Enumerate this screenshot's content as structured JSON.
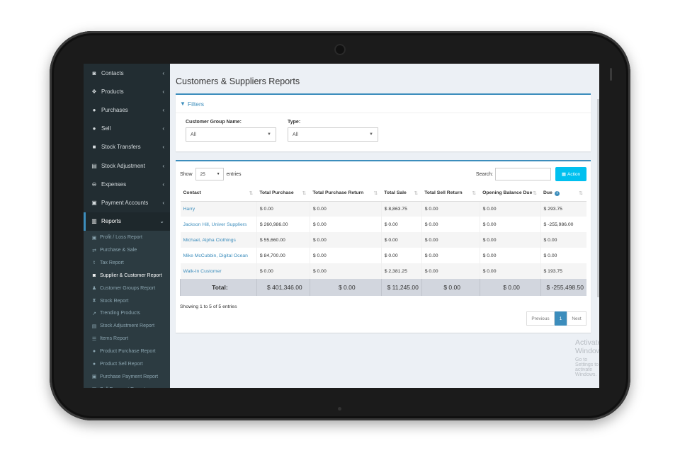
{
  "sidebar": {
    "items": [
      {
        "label": "Contacts",
        "icon": "address-book-icon",
        "glyph": "◙"
      },
      {
        "label": "Products",
        "icon": "cubes-icon",
        "glyph": "❖"
      },
      {
        "label": "Purchases",
        "icon": "arrow-circle-down-icon",
        "glyph": "●"
      },
      {
        "label": "Sell",
        "icon": "arrow-circle-up-icon",
        "glyph": "●"
      },
      {
        "label": "Stock Transfers",
        "icon": "truck-icon",
        "glyph": "■"
      },
      {
        "label": "Stock Adjustment",
        "icon": "database-icon",
        "glyph": "▤"
      },
      {
        "label": "Expenses",
        "icon": "minus-circle-icon",
        "glyph": "⊖"
      },
      {
        "label": "Payment Accounts",
        "icon": "money-icon",
        "glyph": "▣"
      },
      {
        "label": "Reports",
        "icon": "bar-chart-icon",
        "glyph": "▥"
      }
    ],
    "reports_sub": [
      {
        "label": "Profit / Loss Report",
        "icon": "money-icon",
        "glyph": "▣"
      },
      {
        "label": "Purchase & Sale",
        "icon": "exchange-icon",
        "glyph": "⇄"
      },
      {
        "label": "Tax Report",
        "icon": "tumblr-icon",
        "glyph": "t"
      },
      {
        "label": "Supplier & Customer Report",
        "icon": "address-book-icon",
        "glyph": "◙"
      },
      {
        "label": "Customer Groups Report",
        "icon": "users-icon",
        "glyph": "♟"
      },
      {
        "label": "Stock Report",
        "icon": "hourglass-icon",
        "glyph": "⧗"
      },
      {
        "label": "Trending Products",
        "icon": "line-chart-icon",
        "glyph": "↗"
      },
      {
        "label": "Stock Adjustment Report",
        "icon": "database-icon",
        "glyph": "▤"
      },
      {
        "label": "Items Report",
        "icon": "tasks-icon",
        "glyph": "☰"
      },
      {
        "label": "Product Purchase Report",
        "icon": "arrow-circle-down-icon",
        "glyph": "●"
      },
      {
        "label": "Product Sell Report",
        "icon": "arrow-circle-up-icon",
        "glyph": "●"
      },
      {
        "label": "Purchase Payment Report",
        "icon": "money-icon",
        "glyph": "▣"
      },
      {
        "label": "Sell Payment Report",
        "icon": "money-icon",
        "glyph": "▣"
      }
    ]
  },
  "page": {
    "title": "Customers & Suppliers Reports"
  },
  "filters": {
    "title": "Filters",
    "group_label": "Customer Group Name:",
    "group_value": "All",
    "type_label": "Type:",
    "type_value": "All"
  },
  "table_controls": {
    "show_label": "Show",
    "entries_value": "25",
    "entries_label": "entries",
    "search_label": "Search:",
    "action_label": "Action"
  },
  "table": {
    "columns": [
      "Contact",
      "Total Purchase",
      "Total Purchase Return",
      "Total Sale",
      "Total Sell Return",
      "Opening Balance Due",
      "Due"
    ],
    "rows": [
      [
        "Harry",
        "$ 0.00",
        "$ 0.00",
        "$ 8,863.75",
        "$ 0.00",
        "$ 0.00",
        "$ 293.75"
      ],
      [
        "Jackson Hill, Univer Suppliers",
        "$ 260,986.00",
        "$ 0.00",
        "$ 0.00",
        "$ 0.00",
        "$ 0.00",
        "$ -255,986.00"
      ],
      [
        "Michael, Alpha Clothings",
        "$ 55,660.00",
        "$ 0.00",
        "$ 0.00",
        "$ 0.00",
        "$ 0.00",
        "$ 0.00"
      ],
      [
        "Mike McCubbin, Digital Ocean",
        "$ 84,700.00",
        "$ 0.00",
        "$ 0.00",
        "$ 0.00",
        "$ 0.00",
        "$ 0.00"
      ],
      [
        "Walk-In Customer",
        "$ 0.00",
        "$ 0.00",
        "$ 2,381.25",
        "$ 0.00",
        "$ 0.00",
        "$ 193.75"
      ]
    ],
    "total_label": "Total:",
    "totals": [
      "$ 401,346.00",
      "$ 0.00",
      "$ 11,245.00",
      "$ 0.00",
      "$ 0.00",
      "$ -255,498.50"
    ]
  },
  "info_text": "Showing 1 to 5 of 5 entries",
  "pagination": {
    "previous": "Previous",
    "current": "1",
    "next": "Next"
  },
  "watermark": {
    "title": "Activate Windows",
    "subtitle": "Go to Settings to activate Windows."
  },
  "colors": {
    "primary": "#3c8dbc",
    "sidebar": "#222d32",
    "action": "#00c0ef"
  }
}
